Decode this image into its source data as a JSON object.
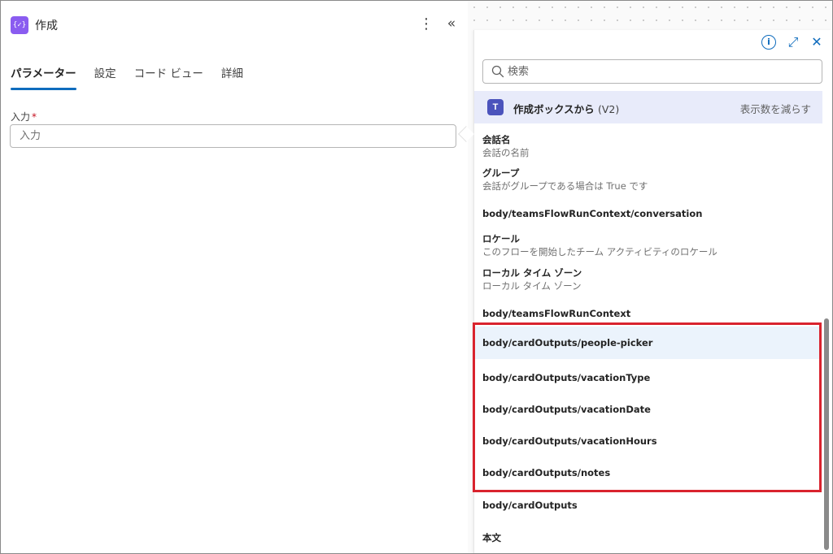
{
  "left_panel": {
    "title": "作成",
    "action_icon_text": "{✓}",
    "tabs": [
      {
        "label": "パラメーター",
        "active": true
      },
      {
        "label": "設定",
        "active": false
      },
      {
        "label": "コード ビュー",
        "active": false
      },
      {
        "label": "詳細",
        "active": false
      }
    ],
    "input_label": "入力",
    "input_required_mark": "*",
    "input_placeholder": "入力"
  },
  "popup": {
    "search_placeholder": "検索",
    "source_title": "作成ボックスから",
    "source_version": "(V2)",
    "show_less": "表示数を減らす",
    "items": [
      {
        "title": "会話名",
        "desc": "会話の名前"
      },
      {
        "title": "グループ",
        "desc": "会話がグループである場合は True です"
      },
      {
        "title": "body/teamsFlowRunContext/conversation",
        "desc": ""
      },
      {
        "title": "ロケール",
        "desc": "このフローを開始したチーム アクティビティのロケール"
      },
      {
        "title": "ローカル タイム ゾーン",
        "desc": "ローカル タイム ゾーン"
      },
      {
        "title": "body/teamsFlowRunContext",
        "desc": ""
      },
      {
        "title": "body/cardOutputs/people-picker",
        "desc": ""
      },
      {
        "title": "body/cardOutputs/vacationType",
        "desc": ""
      },
      {
        "title": "body/cardOutputs/vacationDate",
        "desc": ""
      },
      {
        "title": "body/cardOutputs/vacationHours",
        "desc": ""
      },
      {
        "title": "body/cardOutputs/notes",
        "desc": ""
      },
      {
        "title": "body/cardOutputs",
        "desc": ""
      },
      {
        "title": "本文",
        "desc": ""
      }
    ]
  },
  "colors": {
    "accent": "#0f6cbd",
    "highlight": "#d9232e",
    "source_header_bg": "#e8ebfa",
    "teams": "#4b53bc",
    "action": "#8a5cf0"
  },
  "icons": {
    "action": "compose-icon",
    "more": "more-vertical-icon",
    "collapse": "double-chevron-left-icon",
    "info": "info-icon",
    "expand": "expand-icon",
    "close": "close-icon",
    "search": "search-icon",
    "teams": "teams-icon"
  }
}
